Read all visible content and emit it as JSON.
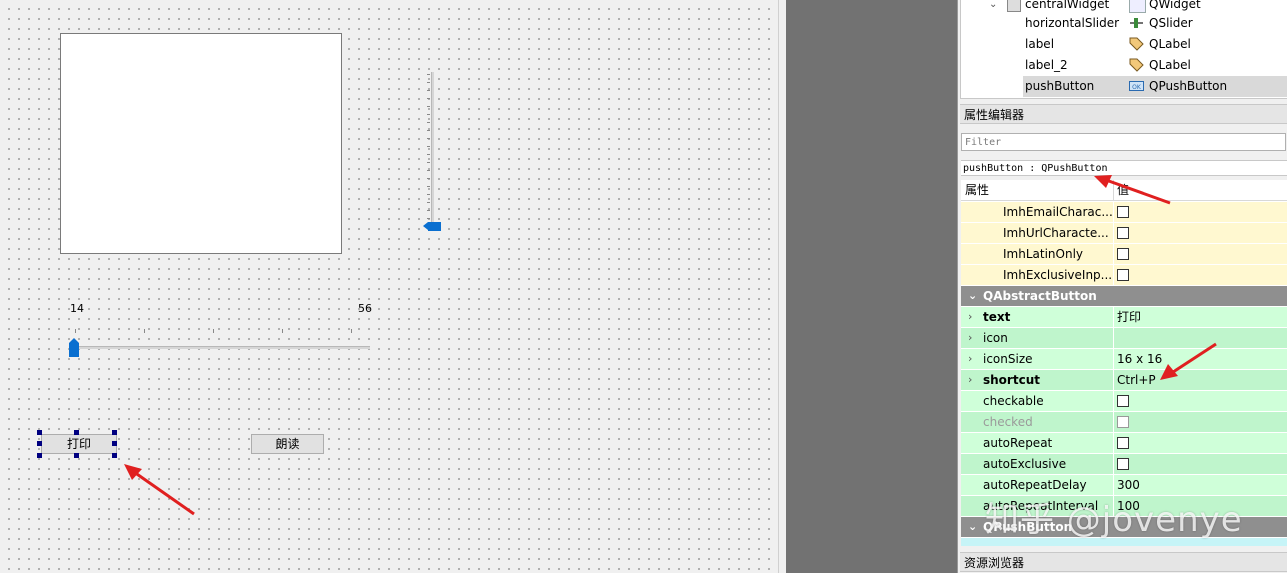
{
  "canvas": {
    "slider_min_label": "14",
    "slider_max_label": "56",
    "print_button": "打印",
    "read_button": "朗读"
  },
  "object_inspector": {
    "rows": [
      {
        "name": "centralWidget",
        "class": "QWidget"
      },
      {
        "name": "horizontalSlider",
        "class": "QSlider"
      },
      {
        "name": "label",
        "class": "QLabel"
      },
      {
        "name": "label_2",
        "class": "QLabel"
      },
      {
        "name": "pushButton",
        "class": "QPushButton"
      }
    ]
  },
  "property_editor": {
    "title": "属性编辑器",
    "filter_placeholder": "Filter",
    "object_path": "pushButton : QPushButton",
    "header_property": "属性",
    "header_value": "值",
    "rows": [
      {
        "name": "ImhEmailCharac...",
        "value": ""
      },
      {
        "name": "ImhUrlCharacte...",
        "value": ""
      },
      {
        "name": "ImhLatinOnly",
        "value": ""
      },
      {
        "name": "ImhExclusiveInp...",
        "value": ""
      },
      {
        "name": "QAbstractButton",
        "value": ""
      },
      {
        "name": "text",
        "value": "打印"
      },
      {
        "name": "icon",
        "value": ""
      },
      {
        "name": "iconSize",
        "value": "16 x 16"
      },
      {
        "name": "shortcut",
        "value": "Ctrl+P"
      },
      {
        "name": "checkable",
        "value": ""
      },
      {
        "name": "checked",
        "value": ""
      },
      {
        "name": "autoRepeat",
        "value": ""
      },
      {
        "name": "autoExclusive",
        "value": ""
      },
      {
        "name": "autoRepeatDelay",
        "value": "300"
      },
      {
        "name": "autoRepeatInterval",
        "value": "100"
      },
      {
        "name": "QPushButton",
        "value": ""
      }
    ]
  },
  "resource_browser": {
    "title": "资源浏览器"
  },
  "watermark": "知乎 @jovenye",
  "colors": {
    "accent_blue": "#0a6fd0",
    "arrow_red": "#e02020",
    "row_yellow": "#fff8d0",
    "row_green": "#cfffd9",
    "group_gray": "#8f8f8f"
  }
}
